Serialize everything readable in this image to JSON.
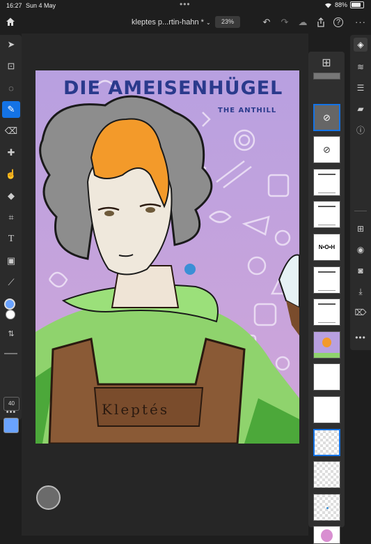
{
  "status": {
    "time": "16:27",
    "date": "Sun 4 May",
    "battery": "88%",
    "battery_level": 0.88,
    "more": "•••"
  },
  "topbar": {
    "document_title": "kleptes p...rtin-hahn *",
    "zoom": "23%",
    "more": "···"
  },
  "tools": {
    "items": [
      "select-tool",
      "transform-tool",
      "lasso-tool",
      "brush-tool",
      "eraser-tool",
      "healing-tool",
      "smudge-tool",
      "fill-tool",
      "crop-tool",
      "type-tool",
      "image-tool",
      "eyedropper-tool"
    ],
    "active": "brush-tool",
    "brush_size": "40",
    "primary_color": "#6aa3ff",
    "secondary_color": "#ffffff"
  },
  "artwork": {
    "title": "DIE AMEISENHÜGEL",
    "subtitle": "THE ANTHILL",
    "name_badge": "Kleptés"
  },
  "layers": {
    "thumbs": [
      "blank",
      "mask-hidden-selected",
      "mask-hidden",
      "text-doc",
      "sketch",
      "text-logo",
      "lineart",
      "lineart-small",
      "character",
      "white",
      "white",
      "checker-selected",
      "checker",
      "checker-dot",
      "pink-figure"
    ]
  },
  "colors": {
    "accent": "#1473e6",
    "bg": "#1e1e1e",
    "panel": "#2b2b2b"
  }
}
